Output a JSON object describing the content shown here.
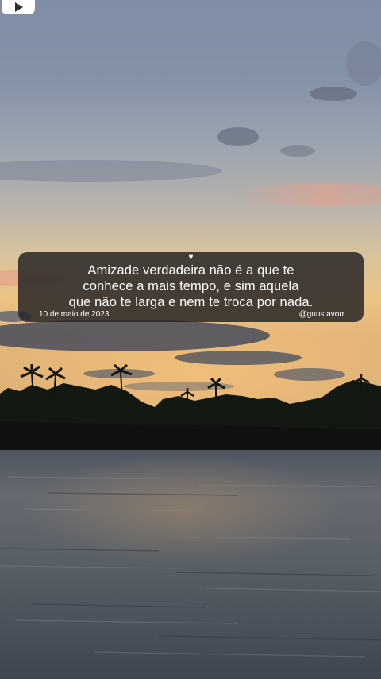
{
  "quote": {
    "heart_icon": "♥",
    "lines": [
      "Amizade verdadeira não é a que te",
      "conhece a mais tempo, e sim aquela",
      "que não te larga e nem te troca por nada."
    ],
    "date": "10 de maio de 2023",
    "handle": "@guustavorr"
  },
  "icons": {
    "play": "play-icon",
    "heart": "heart-icon"
  },
  "colors": {
    "card_background": "#2a2628",
    "text": "#ffffff",
    "sunset_glow": "#f0b870",
    "water": "#5b6168"
  }
}
